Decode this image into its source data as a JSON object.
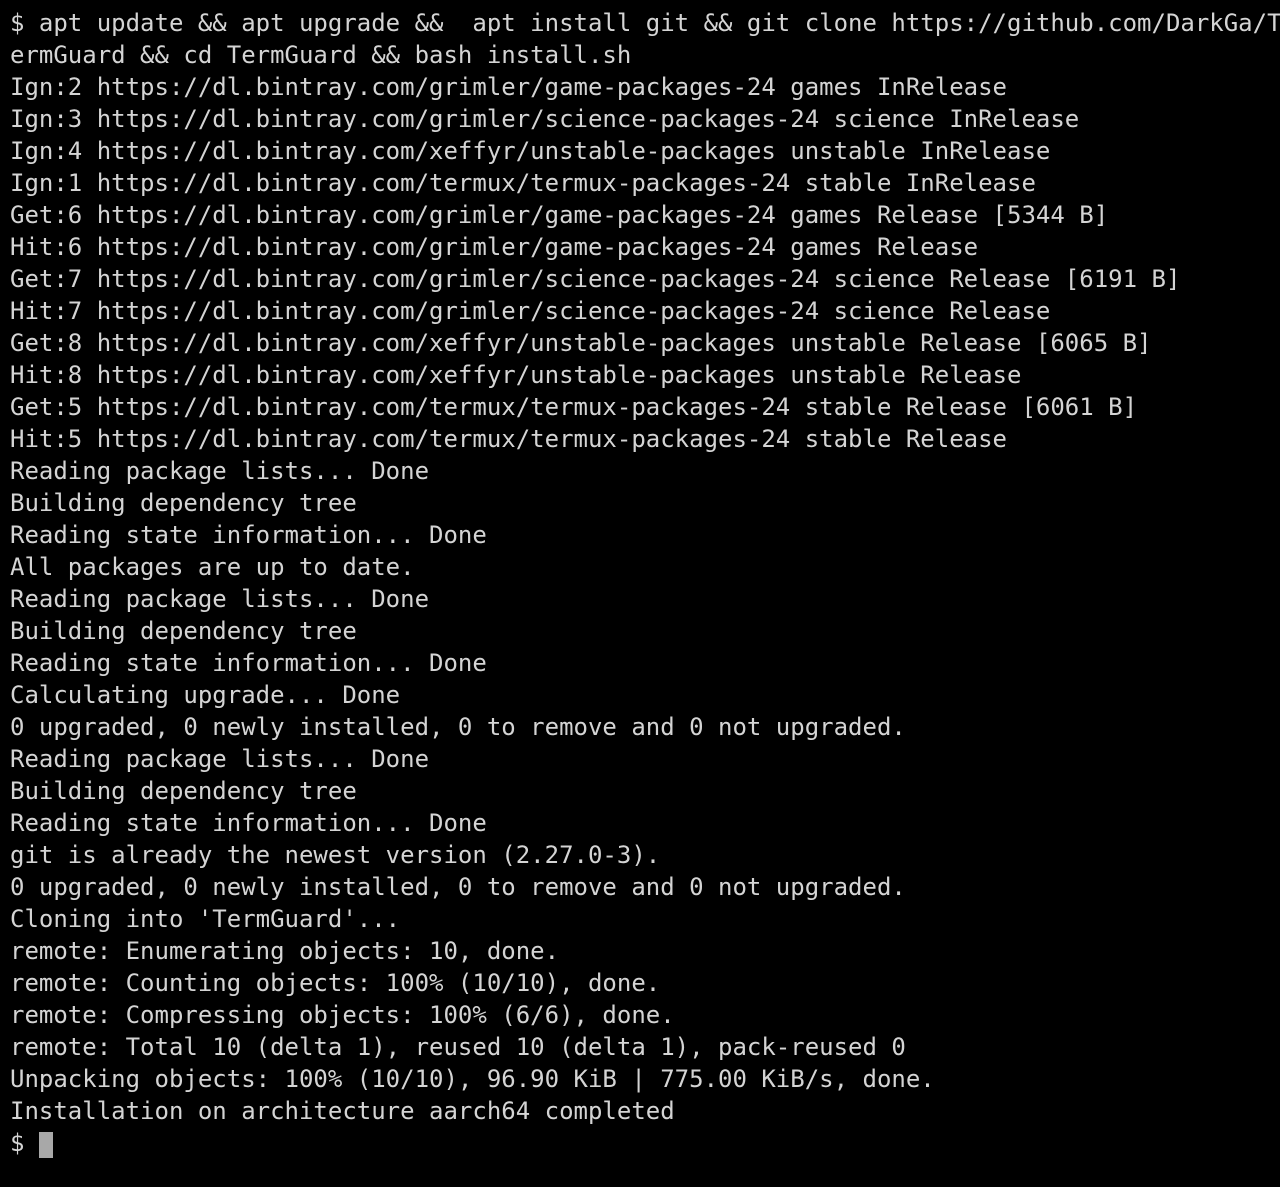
{
  "terminal": {
    "background_color": "#000000",
    "text_color": "#d4d4d4",
    "cursor_color": "#a8a8a8",
    "cursor_glyph": "block-cursor",
    "prompt_symbol": "$",
    "lines": [
      "$ apt update && apt upgrade &&  apt install git && git clone https://github.com/DarkGa/T",
      "ermGuard && cd TermGuard && bash install.sh",
      "Ign:2 https://dl.bintray.com/grimler/game-packages-24 games InRelease",
      "Ign:3 https://dl.bintray.com/grimler/science-packages-24 science InRelease",
      "Ign:4 https://dl.bintray.com/xeffyr/unstable-packages unstable InRelease",
      "Ign:1 https://dl.bintray.com/termux/termux-packages-24 stable InRelease",
      "Get:6 https://dl.bintray.com/grimler/game-packages-24 games Release [5344 B]",
      "Hit:6 https://dl.bintray.com/grimler/game-packages-24 games Release",
      "Get:7 https://dl.bintray.com/grimler/science-packages-24 science Release [6191 B]",
      "Hit:7 https://dl.bintray.com/grimler/science-packages-24 science Release",
      "Get:8 https://dl.bintray.com/xeffyr/unstable-packages unstable Release [6065 B]",
      "Hit:8 https://dl.bintray.com/xeffyr/unstable-packages unstable Release",
      "Get:5 https://dl.bintray.com/termux/termux-packages-24 stable Release [6061 B]",
      "Hit:5 https://dl.bintray.com/termux/termux-packages-24 stable Release",
      "Reading package lists... Done",
      "Building dependency tree",
      "Reading state information... Done",
      "All packages are up to date.",
      "Reading package lists... Done",
      "Building dependency tree",
      "Reading state information... Done",
      "Calculating upgrade... Done",
      "0 upgraded, 0 newly installed, 0 to remove and 0 not upgraded.",
      "Reading package lists... Done",
      "Building dependency tree",
      "Reading state information... Done",
      "git is already the newest version (2.27.0-3).",
      "0 upgraded, 0 newly installed, 0 to remove and 0 not upgraded.",
      "Cloning into 'TermGuard'...",
      "remote: Enumerating objects: 10, done.",
      "remote: Counting objects: 100% (10/10), done.",
      "remote: Compressing objects: 100% (6/6), done.",
      "remote: Total 10 (delta 1), reused 10 (delta 1), pack-reused 0",
      "Unpacking objects: 100% (10/10), 96.90 KiB | 775.00 KiB/s, done.",
      "Installation on architecture aarch64 completed"
    ]
  }
}
